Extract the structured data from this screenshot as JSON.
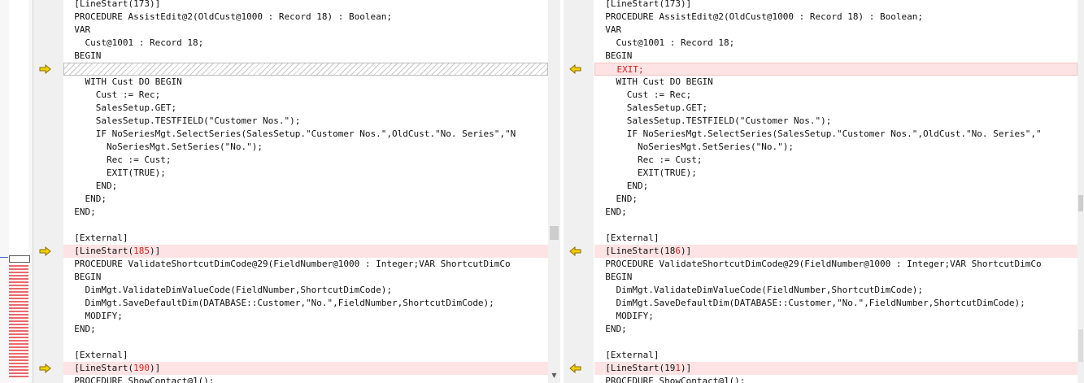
{
  "colors": {
    "changed_bg": "#fde3e3",
    "changed_text": "#d31f1f",
    "left_arrow_fill": "#f4d000",
    "overview_marker": "#e9696b"
  },
  "icons": {
    "left_change": "arrow-right-icon",
    "right_change": "arrow-left-icon"
  },
  "left": {
    "lines": [
      "  [LineStart(173)]",
      "  PROCEDURE AssistEdit@2(OldCust@1000 : Record 18) : Boolean;",
      "  VAR",
      "    Cust@1001 : Record 18;",
      "  BEGIN",
      "",
      "    WITH Cust DO BEGIN",
      "      Cust := Rec;",
      "      SalesSetup.GET;",
      "      SalesSetup.TESTFIELD(\"Customer Nos.\");",
      "      IF NoSeriesMgt.SelectSeries(SalesSetup.\"Customer Nos.\",OldCust.\"No. Series\",\"N",
      "        NoSeriesMgt.SetSeries(\"No.\");",
      "        Rec := Cust;",
      "        EXIT(TRUE);",
      "      END;",
      "    END;",
      "  END;",
      "",
      "  [External]",
      "  [LineStart(",
      "  PROCEDURE ValidateShortcutDimCode@29(FieldNumber@1000 : Integer;VAR ShortcutDimCo",
      "  BEGIN",
      "    DimMgt.ValidateDimValueCode(FieldNumber,ShortcutDimCode);",
      "    DimMgt.SaveDefaultDim(DATABASE::Customer,\"No.\",FieldNumber,ShortcutDimCode);",
      "    MODIFY;",
      "  END;",
      "",
      "  [External]",
      "  [LineStart(",
      "  PROCEDURE ShowContact@1();"
    ],
    "diff_185": "185",
    "diff_190": "190",
    "tail": ")]"
  },
  "right": {
    "lines": [
      "  [LineStart(173)]",
      "  PROCEDURE AssistEdit@2(OldCust@1000 : Record 18) : Boolean;",
      "  VAR",
      "    Cust@1001 : Record 18;",
      "  BEGIN",
      "    EXIT;",
      "    WITH Cust DO BEGIN",
      "      Cust := Rec;",
      "      SalesSetup.GET;",
      "      SalesSetup.TESTFIELD(\"Customer Nos.\");",
      "      IF NoSeriesMgt.SelectSeries(SalesSetup.\"Customer Nos.\",OldCust.\"No. Series\",\"",
      "        NoSeriesMgt.SetSeries(\"No.\");",
      "        Rec := Cust;",
      "        EXIT(TRUE);",
      "      END;",
      "    END;",
      "  END;",
      "",
      "  [External]",
      "  [LineStart(18",
      "  PROCEDURE ValidateShortcutDimCode@29(FieldNumber@1000 : Integer;VAR ShortcutDimCo",
      "  BEGIN",
      "    DimMgt.ValidateDimValueCode(FieldNumber,ShortcutDimCode);",
      "    DimMgt.SaveDefaultDim(DATABASE::Customer,\"No.\",FieldNumber,ShortcutDimCode);",
      "    MODIFY;",
      "  END;",
      "",
      "  [External]",
      "  [LineStart(19",
      "  PROCEDURE ShowContact@1();"
    ],
    "diff_186": "6",
    "diff_191": "1",
    "tail": ")]"
  },
  "scrollbar": {
    "up_glyph": "▲",
    "down_glyph": "▼"
  }
}
